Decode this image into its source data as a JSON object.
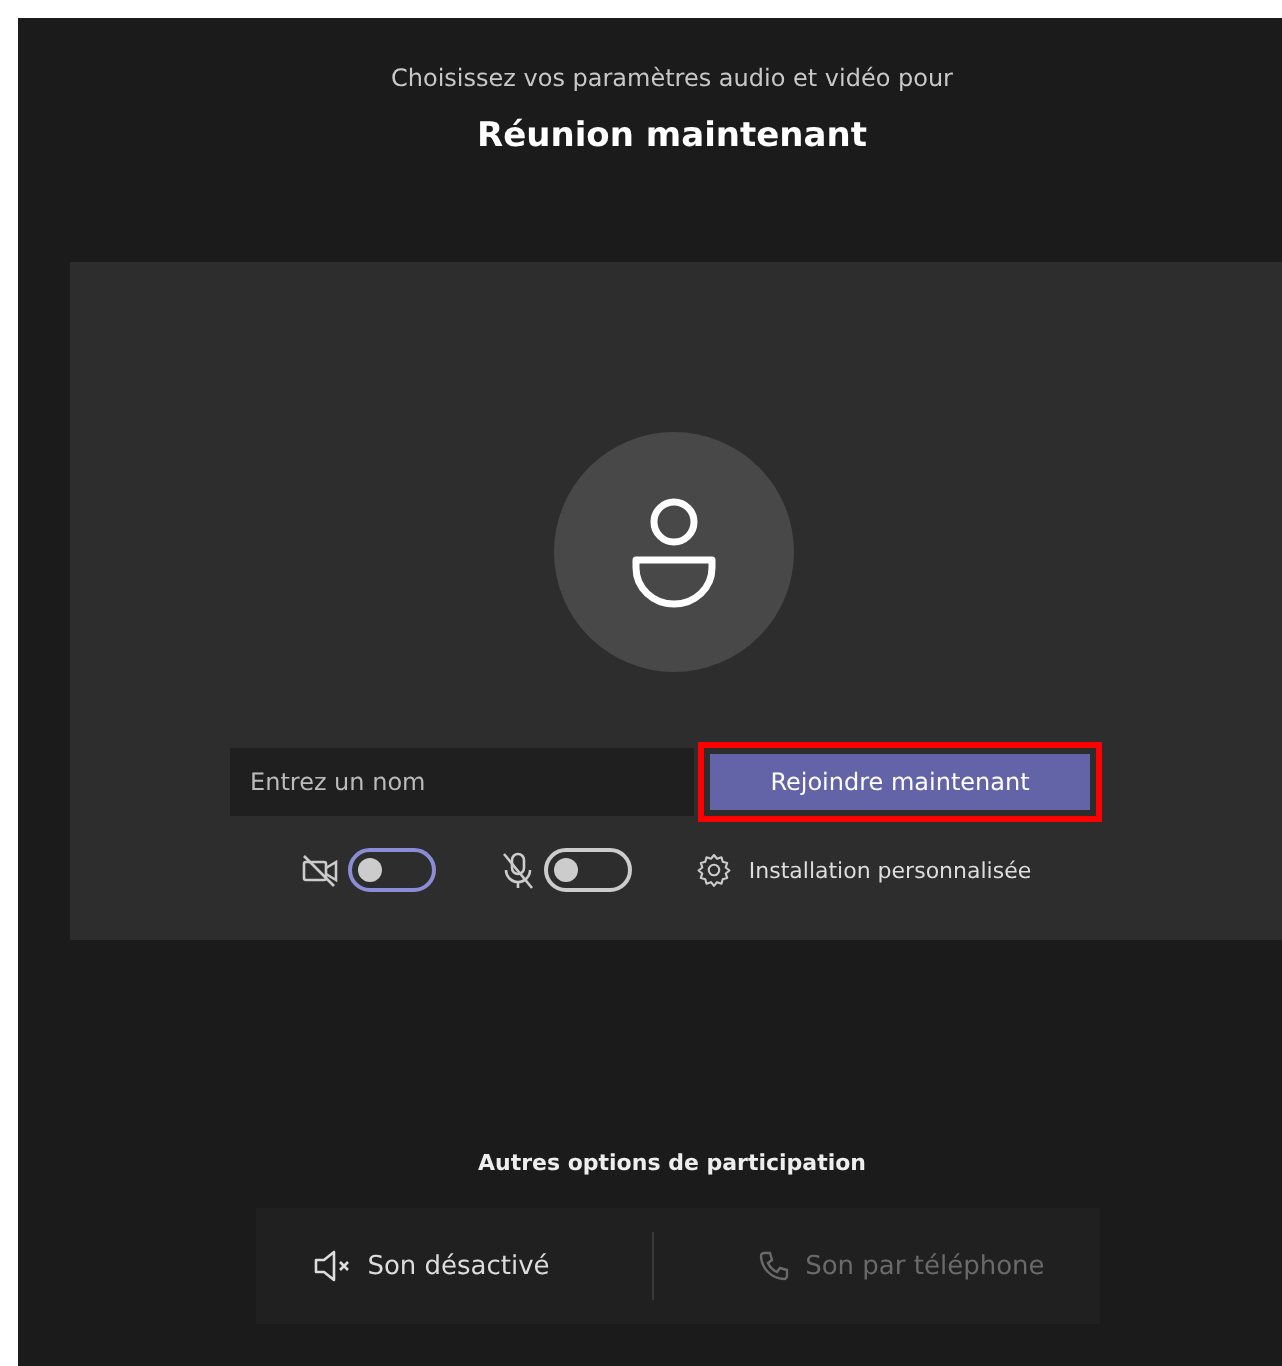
{
  "subtitle": "Choisissez vos paramètres audio et vidéo pour",
  "title": "Réunion maintenant",
  "name_field": {
    "placeholder": "Entrez un nom"
  },
  "join_button": {
    "label": "Rejoindre maintenant",
    "highlighted": true
  },
  "toggles": [
    {
      "kind": "camera",
      "on": false,
      "color": "#8b8cd6"
    },
    {
      "kind": "mic",
      "on": false,
      "color": "#cccccc"
    }
  ],
  "settings_link": "Installation personnalisée",
  "other_options_title": "Autres options de participation",
  "other_options": [
    {
      "kind": "speaker",
      "label": "Son désactivé",
      "disabled": false
    },
    {
      "kind": "phone",
      "label": "Son par téléphone",
      "disabled": true
    }
  ]
}
